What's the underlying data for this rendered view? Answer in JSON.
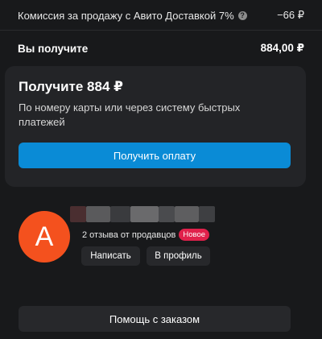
{
  "summary": {
    "fee_label": "Комиссия за продажу с Авито Доставкой 7%",
    "fee_value": "−66 ₽",
    "total_label": "Вы получите",
    "total_value": "884,00 ₽"
  },
  "payout_card": {
    "title": "Получите 884 ₽",
    "description": "По номеру карты или через систему быстрых платежей",
    "button_label": "Получить оплату",
    "button_color": "#0a8bd6"
  },
  "buyer": {
    "avatar_letter": "A",
    "avatar_color": "#f4511e",
    "reviews_text": "2 отзыва от продавцов",
    "badge_text": "Новое",
    "badge_color": "#e0214b",
    "write_button": "Написать",
    "profile_button": "В профиль"
  },
  "help_button": "Помощь с заказом"
}
